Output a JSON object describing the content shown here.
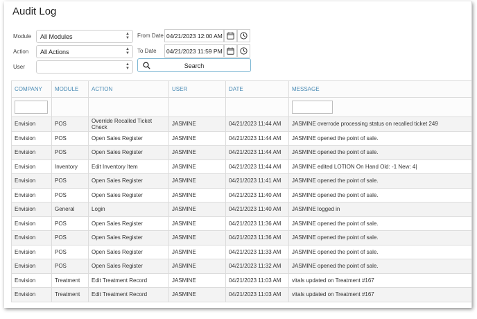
{
  "page": {
    "title": "Audit Log"
  },
  "filters": {
    "module_label": "Module",
    "module_value": "All Modules",
    "action_label": "Action",
    "action_value": "All Actions",
    "user_label": "User",
    "user_value": "",
    "from_date_label": "From Date",
    "from_date_value": "04/21/2023 12:00 AM",
    "to_date_label": "To Date",
    "to_date_value": "04/21/2023 11:59 PM",
    "search_label": "Search"
  },
  "table": {
    "columns": [
      "COMPANY",
      "MODULE",
      "ACTION",
      "USER",
      "DATE",
      "MESSAGE"
    ],
    "rows": [
      [
        "Envision",
        "POS",
        "Override Recalled Ticket Check",
        "JASMINE",
        "04/21/2023 11:44 AM",
        "JASMINE overrode processing status on recalled ticket 249"
      ],
      [
        "Envision",
        "POS",
        "Open Sales Register",
        "JASMINE",
        "04/21/2023 11:44 AM",
        "JASMINE opened the point of sale."
      ],
      [
        "Envision",
        "POS",
        "Open Sales Register",
        "JASMINE",
        "04/21/2023 11:44 AM",
        "JASMINE opened the point of sale."
      ],
      [
        "Envision",
        "Inventory",
        "Edit Inventory Item",
        "JASMINE",
        "04/21/2023 11:44 AM",
        "JASMINE edited LOTION On Hand Old: -1 New: 4|"
      ],
      [
        "Envision",
        "POS",
        "Open Sales Register",
        "JASMINE",
        "04/21/2023 11:41 AM",
        "JASMINE opened the point of sale."
      ],
      [
        "Envision",
        "POS",
        "Open Sales Register",
        "JASMINE",
        "04/21/2023 11:40 AM",
        "JASMINE opened the point of sale."
      ],
      [
        "Envision",
        "General",
        "Login",
        "JASMINE",
        "04/21/2023 11:40 AM",
        "JASMINE logged in"
      ],
      [
        "Envision",
        "POS",
        "Open Sales Register",
        "JASMINE",
        "04/21/2023 11:36 AM",
        "JASMINE opened the point of sale."
      ],
      [
        "Envision",
        "POS",
        "Open Sales Register",
        "JASMINE",
        "04/21/2023 11:36 AM",
        "JASMINE opened the point of sale."
      ],
      [
        "Envision",
        "POS",
        "Open Sales Register",
        "JASMINE",
        "04/21/2023 11:33 AM",
        "JASMINE opened the point of sale."
      ],
      [
        "Envision",
        "POS",
        "Open Sales Register",
        "JASMINE",
        "04/21/2023 11:32 AM",
        "JASMINE opened the point of sale."
      ],
      [
        "Envision",
        "Treatment",
        "Edit Treatment Record",
        "JASMINE",
        "04/21/2023 11:03 AM",
        "vitals updated on Treatment #167"
      ],
      [
        "Envision",
        "Treatment",
        "Edit Treatment Record",
        "JASMINE",
        "04/21/2023 11:03 AM",
        "vitals updated on Treatment #167"
      ]
    ]
  }
}
